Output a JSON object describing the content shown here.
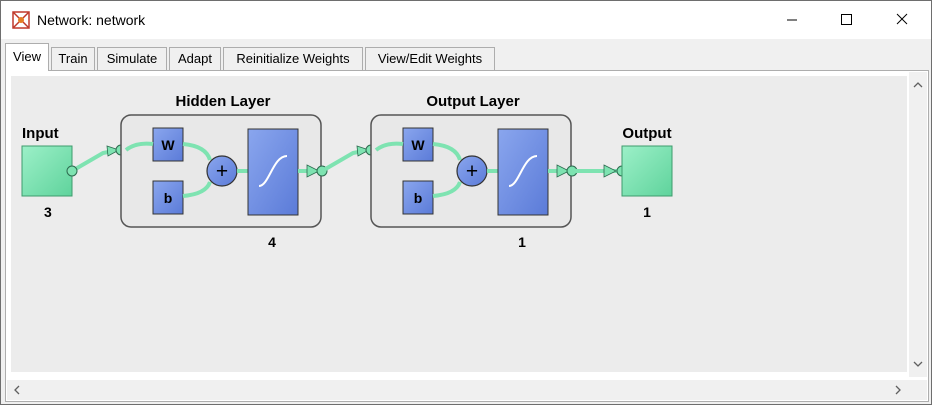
{
  "window": {
    "title": "Network: network"
  },
  "tabs": [
    {
      "label": "View",
      "active": true
    },
    {
      "label": "Train"
    },
    {
      "label": "Simulate"
    },
    {
      "label": "Adapt"
    },
    {
      "label": "Reinitialize Weights"
    },
    {
      "label": "View/Edit Weights"
    }
  ],
  "diagram": {
    "input": {
      "label": "Input",
      "size": "3"
    },
    "hidden_layer": {
      "title": "Hidden Layer",
      "weight": "W",
      "bias": "b",
      "plus": "+",
      "size": "4"
    },
    "output_layer": {
      "title": "Output Layer",
      "weight": "W",
      "bias": "b",
      "plus": "+",
      "size": "1"
    },
    "output": {
      "label": "Output",
      "size": "1"
    }
  },
  "colors": {
    "node_green": "#7ee3b1",
    "box_blue": "#6f8fe0",
    "layer_bg": "#e8e8e8",
    "canvas_bg": "#ececec"
  }
}
